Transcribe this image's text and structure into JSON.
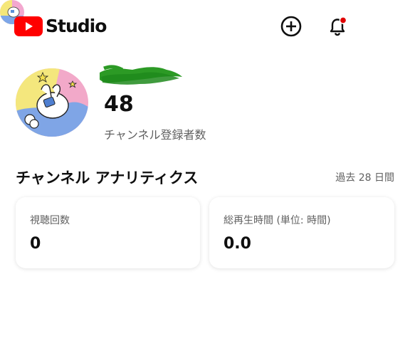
{
  "header": {
    "logo_text": "Studio",
    "brand_color": "#ff0000",
    "icons": [
      "create-icon",
      "notifications-icon",
      "account-avatar"
    ]
  },
  "channel": {
    "subscriber_count": "48",
    "subscriber_label": "チャンネル登録者数"
  },
  "analytics": {
    "title": "チャンネル アナリティクス",
    "period": "過去 28 日間",
    "cards": [
      {
        "label": "視聴回数",
        "value": "0"
      },
      {
        "label": "総再生時間 (単位: 時間)",
        "value": "0.0"
      }
    ]
  }
}
